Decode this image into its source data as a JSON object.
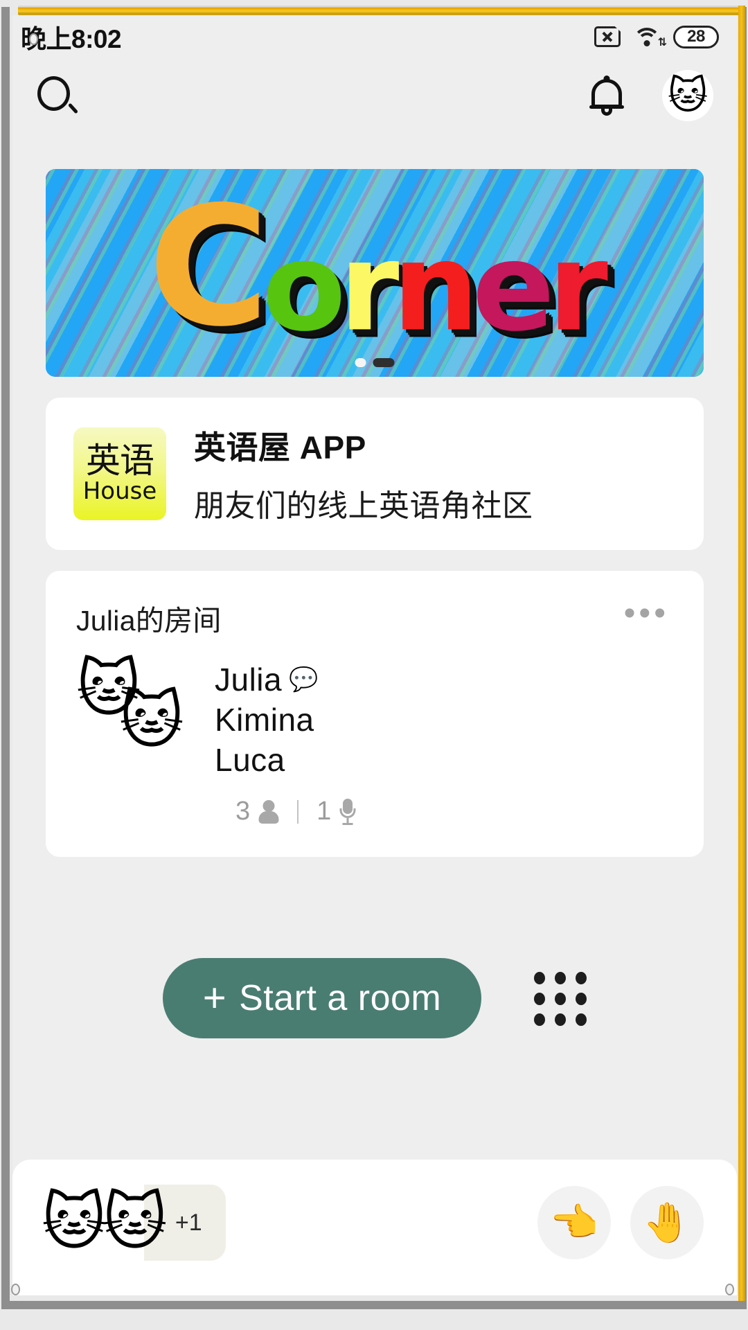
{
  "status_bar": {
    "clock": "晚上8:02",
    "sim_icon": "sim-card-no-service-icon",
    "wifi_icon": "wifi-icon",
    "wifi_data_arrows": "⇅",
    "battery_level": "28"
  },
  "nav_bar": {
    "search_icon": "search-icon",
    "bell_icon": "notifications-bell-icon",
    "avatar": "🐱"
  },
  "banner": {
    "word_letters": [
      "C",
      "o",
      "r",
      "n",
      "e",
      "r"
    ],
    "dots": [
      {
        "active": false
      },
      {
        "active": true
      }
    ]
  },
  "app_card": {
    "logo_cn": "英语",
    "logo_en": "House",
    "name": "英语屋 APP",
    "description": "朋友们的线上英语角社区"
  },
  "room_card": {
    "title": "Julia的房间",
    "more_label": "•••",
    "avatars": [
      "🐱",
      "🐱"
    ],
    "members": [
      {
        "name": "Julia",
        "speaking_bubble": "💬"
      },
      {
        "name": "Kimina",
        "speaking_bubble": ""
      },
      {
        "name": "Luca",
        "speaking_bubble": ""
      }
    ],
    "people_count": "3",
    "person_icon": "person-icon",
    "mic_count": "1",
    "mic_icon": "microphone-icon"
  },
  "cta": {
    "start_room_plus": "+",
    "start_room_label": "Start a room",
    "grid_icon": "apps-grid-icon"
  },
  "bottom_bar": {
    "avatars": [
      "🐱",
      "🐱"
    ],
    "plus_badge": "+1",
    "point_button_icon": "👈",
    "raise_hand_button_icon": "🤚"
  },
  "colors": {
    "accent_teal": "#4a7d72",
    "page_background": "#eeeeee",
    "card_background": "#ffffff",
    "logo_yellow": "#eaf423",
    "banner_blue": "#23a6f5"
  }
}
